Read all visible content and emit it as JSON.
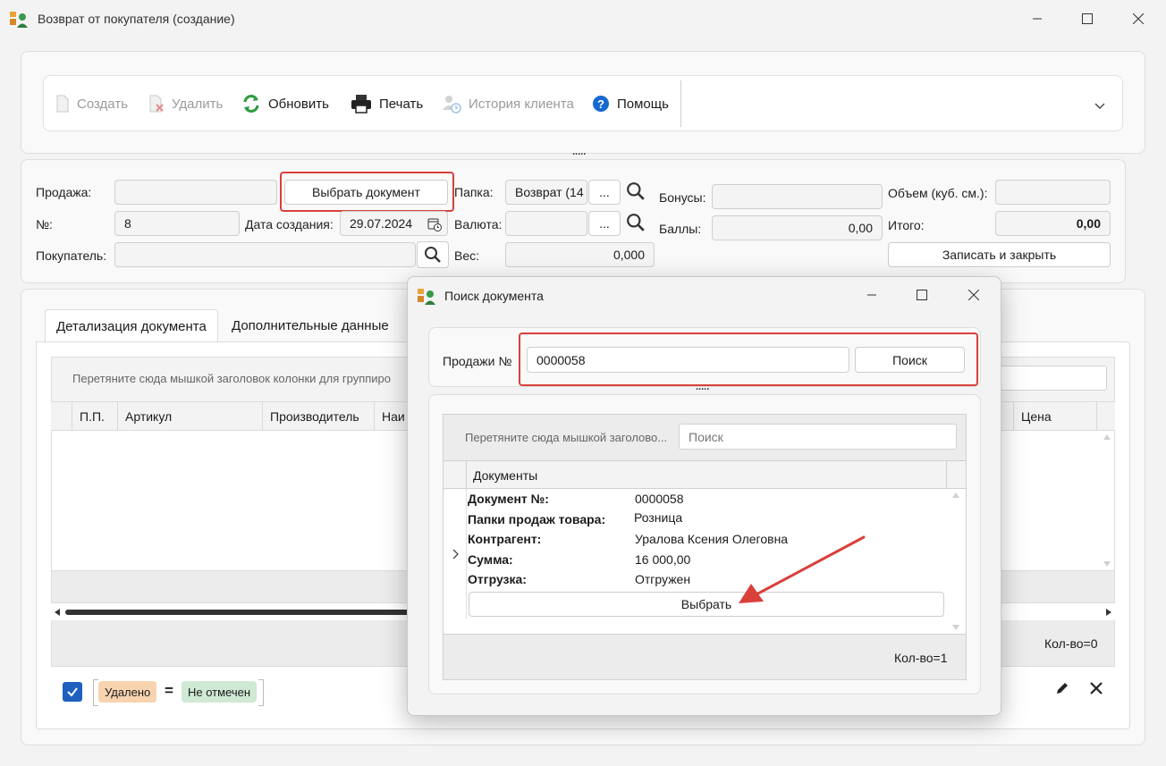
{
  "window": {
    "title": "Возврат от покупателя (создание)"
  },
  "toolbar": {
    "create": "Создать",
    "delete": "Удалить",
    "refresh": "Обновить",
    "print": "Печать",
    "client_history": "История клиента",
    "help": "Помощь",
    "splitter": "....."
  },
  "form": {
    "sale_label": "Продажа:",
    "sale_value": "",
    "choose_doc_button": "Выбрать документ",
    "number_label": "№:",
    "number_value": "8",
    "created_label": "Дата создания:",
    "created_value": "29.07.2024",
    "buyer_label": "Покупатель:",
    "buyer_value": "",
    "folder_label": "Папка:",
    "folder_value": "Возврат (14",
    "currency_label": "Валюта:",
    "currency_value": "",
    "weight_label": "Вес:",
    "weight_value": "0,000",
    "bonus_label": "Бонусы:",
    "bonus_value": "",
    "points_label": "Баллы:",
    "points_value": "0,00",
    "volume_label": "Объем (куб. см.):",
    "volume_value": "",
    "total_label": "Итого:",
    "total_value": "0,00",
    "save_close_button": "Записать и закрыть",
    "ellipsis": "..."
  },
  "tabs": [
    {
      "label": "Детализация документа"
    },
    {
      "label": "Дополнительные данные"
    }
  ],
  "grid": {
    "group_hint": "Перетяните сюда мышкой заголовок колонки для группиро",
    "columns": [
      "П.П.",
      "Артикул",
      "Производитель",
      "Наи",
      "Цена"
    ],
    "count": "Кол-во=0"
  },
  "filter": {
    "field": "Удалено",
    "op": "=",
    "value": "Не отмечен"
  },
  "dialog": {
    "title": "Поиск документа",
    "sale_no_label": "Продажи №",
    "sale_no_value": "0000058",
    "search_button": "Поиск",
    "splitter": ".....",
    "group_hint": "Перетяните сюда мышкой заголово...",
    "search_placeholder": "Поиск",
    "column": "Документы",
    "record": {
      "doc_no_key": "Документ №:",
      "doc_no_val": "0000058",
      "folder_key": "Папки продаж товара:",
      "folder_val": "Розница",
      "contractor_key": "Контрагент:",
      "contractor_val": "Уралова Ксения Олеговна",
      "sum_key": "Сумма:",
      "sum_val": "16 000,00",
      "shipment_key": "Отгрузка:",
      "shipment_val": "Отгружен"
    },
    "select_button": "Выбрать",
    "count": "Кол-во=1"
  },
  "colors": {
    "accent_red": "#d9403a",
    "chip_orange": "#f8d3b0",
    "chip_green": "#cfe9d4",
    "checkbox_blue": "#1f5fbf"
  }
}
